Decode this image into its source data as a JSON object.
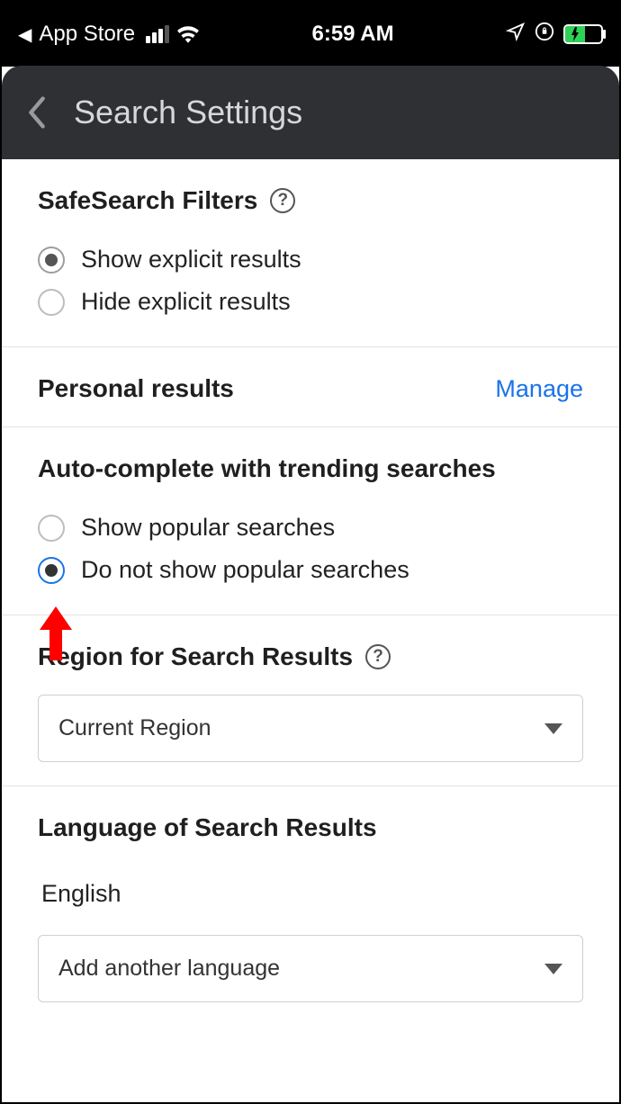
{
  "statusbar": {
    "back_app": "App Store",
    "time": "6:59 AM"
  },
  "header": {
    "title": "Search Settings"
  },
  "sections": {
    "safesearch": {
      "title": "SafeSearch Filters",
      "option_show": "Show explicit results",
      "option_hide": "Hide explicit results"
    },
    "personal": {
      "title": "Personal results",
      "manage": "Manage"
    },
    "autocomplete": {
      "title": "Auto-complete with trending searches",
      "option_show": "Show popular searches",
      "option_hide": "Do not show popular searches"
    },
    "region": {
      "title": "Region for Search Results",
      "value": "Current Region"
    },
    "language": {
      "title": "Language of Search Results",
      "value": "English",
      "add": "Add another language"
    }
  }
}
